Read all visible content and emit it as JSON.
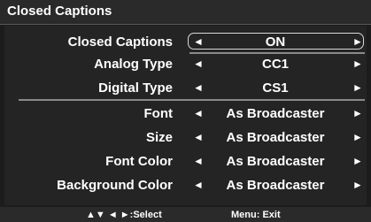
{
  "menu": {
    "title": "Closed Captions"
  },
  "items": [
    {
      "label": "Closed Captions",
      "value": "ON",
      "selected": true
    },
    {
      "label": "Analog Type",
      "value": "CC1"
    },
    {
      "label": "Digital Type",
      "value": "CS1"
    },
    {
      "label": "Font",
      "value": "As Broadcaster"
    },
    {
      "label": "Size",
      "value": "As Broadcaster"
    },
    {
      "label": "Font Color",
      "value": "As Broadcaster"
    },
    {
      "label": "Background Color",
      "value": "As Broadcaster"
    }
  ],
  "footer": {
    "select_hint": ":Select",
    "exit_hint": "Menu: Exit"
  },
  "icons": {
    "left": "arrow-left-icon",
    "right": "arrow-right-icon",
    "nav": "navigation-arrows-icon"
  }
}
